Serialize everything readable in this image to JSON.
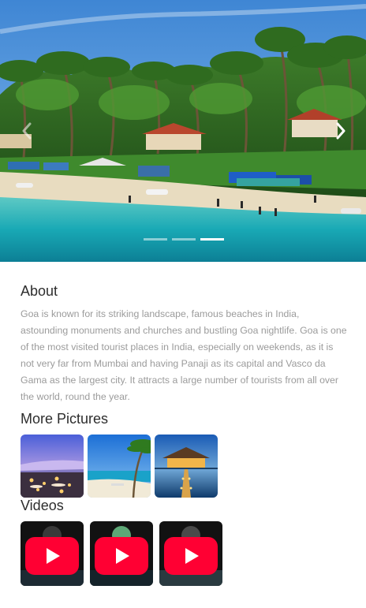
{
  "carousel": {
    "slide_count": 3,
    "active_index": 2,
    "prev_icon": "chevron-left-icon",
    "next_icon": "chevron-right-icon"
  },
  "about": {
    "title": "About",
    "text": "Goa is known for its striking landscape, famous beaches in India, astounding monuments and churches and bustling Goa nightlife. Goa is one of the most visited tourist places in India, especially on weekends, as it is not very far from Mumbai and having Panaji as its capital and Vasco da Gama as the largest city. It attracts a large number of tourists from all over the world, round the year."
  },
  "pictures": {
    "title": "More Pictures",
    "items": [
      "beach-dinner-photo",
      "palm-beach-photo",
      "water-villa-photo"
    ]
  },
  "videos": {
    "title": "Videos",
    "items": [
      "video-1",
      "video-2",
      "video-3"
    ],
    "play_icon": "youtube-play-icon"
  },
  "colors": {
    "text_heading": "#2d2d2d",
    "text_body": "#9b9b9b",
    "youtube_red": "#ff0033"
  }
}
